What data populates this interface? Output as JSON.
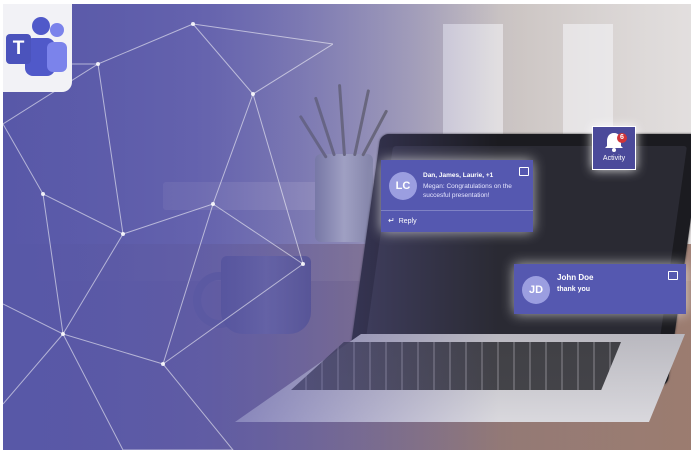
{
  "logo": {
    "letter": "T",
    "icon": "teams-logo-icon",
    "brand_color": "#4b53bc"
  },
  "activity": {
    "label": "Activity",
    "count": "6",
    "icon": "bell-icon"
  },
  "notifications": [
    {
      "avatar": "LC",
      "sender": "Dan, James, Laurie, +1",
      "message": "Megan: Congratulations on the succesful presentation!",
      "action": "Reply",
      "action_icon": "reply-icon",
      "chat_icon": "chat-icon"
    },
    {
      "avatar": "JD",
      "sender": "John Doe",
      "message": "thank you",
      "chat_icon": "chat-icon"
    }
  ],
  "colors": {
    "card": "#5558b0",
    "badge": "#d13438",
    "overlay": "#5a5aa8"
  }
}
